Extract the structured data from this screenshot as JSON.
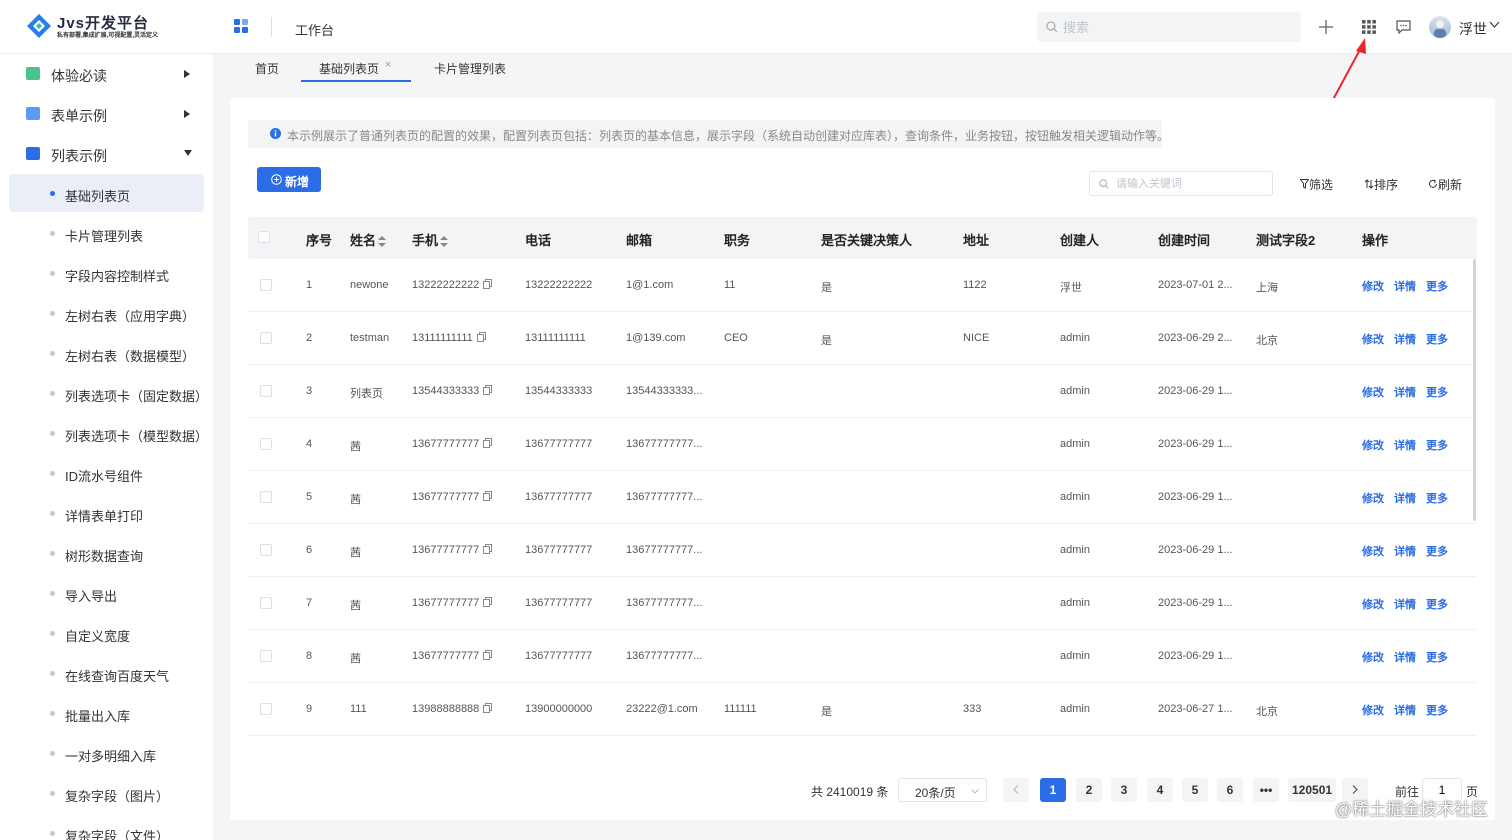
{
  "app": {
    "logo_title": "Jvs开发平台",
    "logo_subtitle": "私有部署,集成扩展,可视配置,灵活定义",
    "workbench": "工作台",
    "search_placeholder": "搜索",
    "user_name": "浮世"
  },
  "sidebar": {
    "groups": [
      {
        "label": "体验必读",
        "icon_color": "#4cc38a"
      },
      {
        "label": "表单示例",
        "icon_color": "#5b9bf3"
      },
      {
        "label": "列表示例",
        "icon_color": "#2b6de5"
      }
    ],
    "items": [
      {
        "label": "基础列表页",
        "active": true
      },
      {
        "label": "卡片管理列表"
      },
      {
        "label": "字段内容控制样式"
      },
      {
        "label": "左树右表（应用字典）"
      },
      {
        "label": "左树右表（数据模型）"
      },
      {
        "label": "列表选项卡（固定数据）"
      },
      {
        "label": "列表选项卡（模型数据）"
      },
      {
        "label": "ID流水号组件"
      },
      {
        "label": "详情表单打印"
      },
      {
        "label": "树形数据查询"
      },
      {
        "label": "导入导出"
      },
      {
        "label": "自定义宽度"
      },
      {
        "label": "在线查询百度天气"
      },
      {
        "label": "批量出入库"
      },
      {
        "label": "一对多明细入库"
      },
      {
        "label": "复杂字段（图片）"
      },
      {
        "label": "复杂字段（文件）"
      }
    ]
  },
  "tabs": [
    {
      "label": "首页"
    },
    {
      "label": "基础列表页",
      "active": true,
      "close": "×"
    },
    {
      "label": "卡片管理列表"
    }
  ],
  "notice": "本示例展示了普通列表页的配置的效果，配置列表页包括：列表页的基本信息，展示字段（系统自动创建对应库表），查询条件，业务按钮，按钮触发相关逻辑动作等。",
  "toolbar": {
    "add_label": "新增",
    "keyword_placeholder": "请输入关键词",
    "filter_label": "筛选",
    "sort_label": "排序",
    "refresh_label": "刷新"
  },
  "table": {
    "columns": [
      "序号",
      "姓名",
      "手机",
      "电话",
      "邮箱",
      "职务",
      "是否关键决策人",
      "地址",
      "创建人",
      "创建时间",
      "测试字段2",
      "操作"
    ],
    "actions": [
      "修改",
      "详情",
      "更多"
    ],
    "rows": [
      {
        "no": "1",
        "name": "newone",
        "mobile": "13222222222",
        "phone": "13222222222",
        "email": "1@1.com",
        "title": "11",
        "key": "是",
        "addr": "1122",
        "creator": "浮世",
        "created": "2023-07-01 2...",
        "test2": "上海"
      },
      {
        "no": "2",
        "name": "testman",
        "mobile": "13111111111",
        "phone": "13111111111",
        "email": "1@139.com",
        "title": "CEO",
        "key": "是",
        "addr": "NICE",
        "creator": "admin",
        "created": "2023-06-29 2...",
        "test2": "北京"
      },
      {
        "no": "3",
        "name": "列表页",
        "mobile": "13544333333",
        "phone": "13544333333",
        "email": "13544333333...",
        "title": "",
        "key": "",
        "addr": "",
        "creator": "admin",
        "created": "2023-06-29 1...",
        "test2": ""
      },
      {
        "no": "4",
        "name": "茜",
        "mobile": "13677777777",
        "phone": "13677777777",
        "email": "13677777777...",
        "title": "",
        "key": "",
        "addr": "",
        "creator": "admin",
        "created": "2023-06-29 1...",
        "test2": ""
      },
      {
        "no": "5",
        "name": "茜",
        "mobile": "13677777777",
        "phone": "13677777777",
        "email": "13677777777...",
        "title": "",
        "key": "",
        "addr": "",
        "creator": "admin",
        "created": "2023-06-29 1...",
        "test2": ""
      },
      {
        "no": "6",
        "name": "茜",
        "mobile": "13677777777",
        "phone": "13677777777",
        "email": "13677777777...",
        "title": "",
        "key": "",
        "addr": "",
        "creator": "admin",
        "created": "2023-06-29 1...",
        "test2": ""
      },
      {
        "no": "7",
        "name": "茜",
        "mobile": "13677777777",
        "phone": "13677777777",
        "email": "13677777777...",
        "title": "",
        "key": "",
        "addr": "",
        "creator": "admin",
        "created": "2023-06-29 1...",
        "test2": ""
      },
      {
        "no": "8",
        "name": "茜",
        "mobile": "13677777777",
        "phone": "13677777777",
        "email": "13677777777...",
        "title": "",
        "key": "",
        "addr": "",
        "creator": "admin",
        "created": "2023-06-29 1...",
        "test2": ""
      },
      {
        "no": "9",
        "name": "111",
        "mobile": "13988888888",
        "phone": "13900000000",
        "email": "23222@1.com",
        "title": "111111",
        "key": "是",
        "addr": "333",
        "creator": "admin",
        "created": "2023-06-27 1...",
        "test2": "北京"
      }
    ]
  },
  "pagination": {
    "total": "共 2410019 条",
    "page_size": "20条/页",
    "pages": [
      "1",
      "2",
      "3",
      "4",
      "5",
      "6",
      "•••",
      "120501"
    ],
    "current": "1",
    "goto_prefix": "前往",
    "goto_value": "1",
    "goto_suffix": "页"
  },
  "watermark": "@稀土掘金技术社区",
  "colors": {
    "accent": "#2b6de5",
    "arrow": "#e8262b"
  }
}
